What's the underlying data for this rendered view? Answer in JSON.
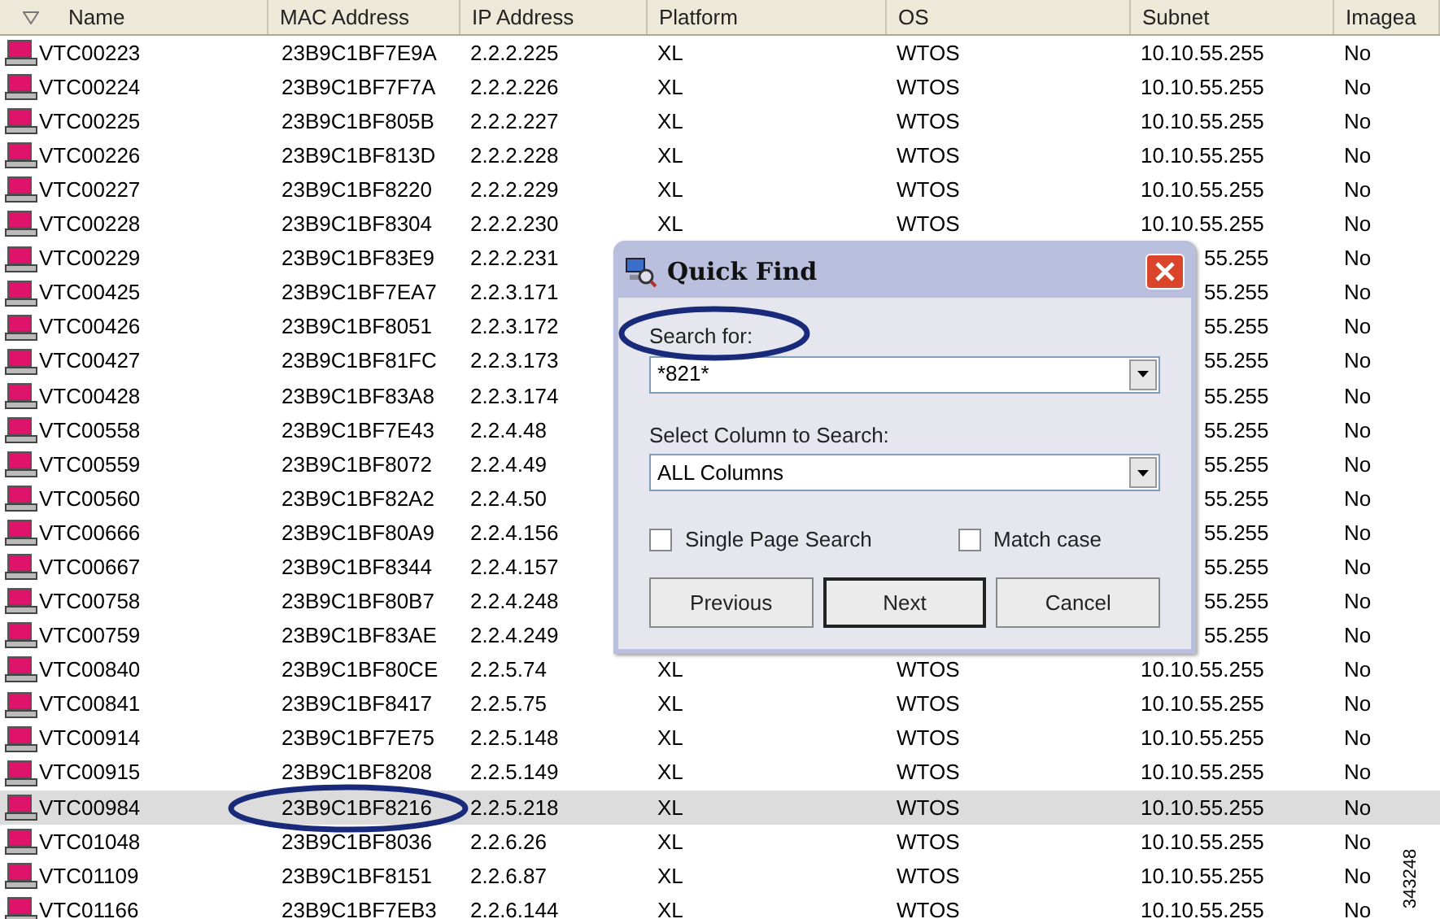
{
  "table": {
    "columns": [
      "Name",
      "MAC Address",
      "IP Address",
      "Platform",
      "OS",
      "Subnet",
      "Imagea"
    ],
    "rows": [
      {
        "name": "VTC00223",
        "mac": "23B9C1BF7E9A",
        "ip": "2.2.2.225",
        "platform": "XL",
        "os": "WTOS",
        "subnet": "10.10.55.255",
        "imageable": "No",
        "selected": false
      },
      {
        "name": "VTC00224",
        "mac": "23B9C1BF7F7A",
        "ip": "2.2.2.226",
        "platform": "XL",
        "os": "WTOS",
        "subnet": "10.10.55.255",
        "imageable": "No",
        "selected": false
      },
      {
        "name": "VTC00225",
        "mac": "23B9C1BF805B",
        "ip": "2.2.2.227",
        "platform": "XL",
        "os": "WTOS",
        "subnet": "10.10.55.255",
        "imageable": "No",
        "selected": false
      },
      {
        "name": "VTC00226",
        "mac": "23B9C1BF813D",
        "ip": "2.2.2.228",
        "platform": "XL",
        "os": "WTOS",
        "subnet": "10.10.55.255",
        "imageable": "No",
        "selected": false
      },
      {
        "name": "VTC00227",
        "mac": "23B9C1BF8220",
        "ip": "2.2.2.229",
        "platform": "XL",
        "os": "WTOS",
        "subnet": "10.10.55.255",
        "imageable": "No",
        "selected": false
      },
      {
        "name": "VTC00228",
        "mac": "23B9C1BF8304",
        "ip": "2.2.2.230",
        "platform": "XL",
        "os": "WTOS",
        "subnet": "10.10.55.255",
        "imageable": "No",
        "selected": false
      },
      {
        "name": "VTC00229",
        "mac": "23B9C1BF83E9",
        "ip": "2.2.2.231",
        "subnet": "55.255",
        "imageable": "No",
        "selected": false
      },
      {
        "name": "VTC00425",
        "mac": "23B9C1BF7EA7",
        "ip": "2.2.3.171",
        "subnet": "55.255",
        "imageable": "No",
        "selected": false
      },
      {
        "name": "VTC00426",
        "mac": "23B9C1BF8051",
        "ip": "2.2.3.172",
        "subnet": "55.255",
        "imageable": "No",
        "selected": false
      },
      {
        "name": "VTC00427",
        "mac": "23B9C1BF81FC",
        "ip": "2.2.3.173",
        "subnet": "55.255",
        "imageable": "No",
        "selected": false
      },
      {
        "name": "VTC00428",
        "mac": "23B9C1BF83A8",
        "ip": "2.2.3.174",
        "subnet": "55.255",
        "imageable": "No",
        "selected": false
      },
      {
        "name": "VTC00558",
        "mac": "23B9C1BF7E43",
        "ip": "2.2.4.48",
        "subnet": "55.255",
        "imageable": "No",
        "selected": false
      },
      {
        "name": "VTC00559",
        "mac": "23B9C1BF8072",
        "ip": "2.2.4.49",
        "subnet": "55.255",
        "imageable": "No",
        "selected": false
      },
      {
        "name": "VTC00560",
        "mac": "23B9C1BF82A2",
        "ip": "2.2.4.50",
        "subnet": "55.255",
        "imageable": "No",
        "selected": false
      },
      {
        "name": "VTC00666",
        "mac": "23B9C1BF80A9",
        "ip": "2.2.4.156",
        "subnet": "55.255",
        "imageable": "No",
        "selected": false
      },
      {
        "name": "VTC00667",
        "mac": "23B9C1BF8344",
        "ip": "2.2.4.157",
        "subnet": "55.255",
        "imageable": "No",
        "selected": false
      },
      {
        "name": "VTC00758",
        "mac": "23B9C1BF80B7",
        "ip": "2.2.4.248",
        "subnet": "55.255",
        "imageable": "No",
        "selected": false
      },
      {
        "name": "VTC00759",
        "mac": "23B9C1BF83AE",
        "ip": "2.2.4.249",
        "subnet": "55.255",
        "imageable": "No",
        "selected": false
      },
      {
        "name": "VTC00840",
        "mac": "23B9C1BF80CE",
        "ip": "2.2.5.74",
        "platform": "XL",
        "os": "WTOS",
        "subnet": "10.10.55.255",
        "imageable": "No",
        "selected": false
      },
      {
        "name": "VTC00841",
        "mac": "23B9C1BF8417",
        "ip": "2.2.5.75",
        "platform": "XL",
        "os": "WTOS",
        "subnet": "10.10.55.255",
        "imageable": "No",
        "selected": false
      },
      {
        "name": "VTC00914",
        "mac": "23B9C1BF7E75",
        "ip": "2.2.5.148",
        "platform": "XL",
        "os": "WTOS",
        "subnet": "10.10.55.255",
        "imageable": "No",
        "selected": false
      },
      {
        "name": "VTC00915",
        "mac": "23B9C1BF8208",
        "ip": "2.2.5.149",
        "platform": "XL",
        "os": "WTOS",
        "subnet": "10.10.55.255",
        "imageable": "No",
        "selected": false
      },
      {
        "name": "VTC00984",
        "mac": "23B9C1BF8216",
        "ip": "2.2.5.218",
        "platform": "XL",
        "os": "WTOS",
        "subnet": "10.10.55.255",
        "imageable": "No",
        "selected": true
      },
      {
        "name": "VTC01048",
        "mac": "23B9C1BF8036",
        "ip": "2.2.6.26",
        "platform": "XL",
        "os": "WTOS",
        "subnet": "10.10.55.255",
        "imageable": "No",
        "selected": false
      },
      {
        "name": "VTC01109",
        "mac": "23B9C1BF8151",
        "ip": "2.2.6.87",
        "platform": "XL",
        "os": "WTOS",
        "subnet": "10.10.55.255",
        "imageable": "No",
        "selected": false
      },
      {
        "name": "VTC01166",
        "mac": "23B9C1BF7EB3",
        "ip": "2.2.6.144",
        "platform": "XL",
        "os": "WTOS",
        "subnet": "10.10.55.255",
        "imageable": "No",
        "selected": false
      }
    ]
  },
  "dialog": {
    "title": "Quick Find",
    "search_label": "Search for:",
    "search_value": "*821*",
    "column_label": "Select Column to Search:",
    "column_value": "ALL Columns",
    "checkboxes": [
      {
        "label": "Single Page Search",
        "checked": false
      },
      {
        "label": "Match case",
        "checked": false
      }
    ],
    "buttons": [
      {
        "label": "Previous",
        "default": false
      },
      {
        "label": "Next",
        "default": true
      },
      {
        "label": "Cancel",
        "default": false
      }
    ]
  },
  "figure_id": "343248"
}
